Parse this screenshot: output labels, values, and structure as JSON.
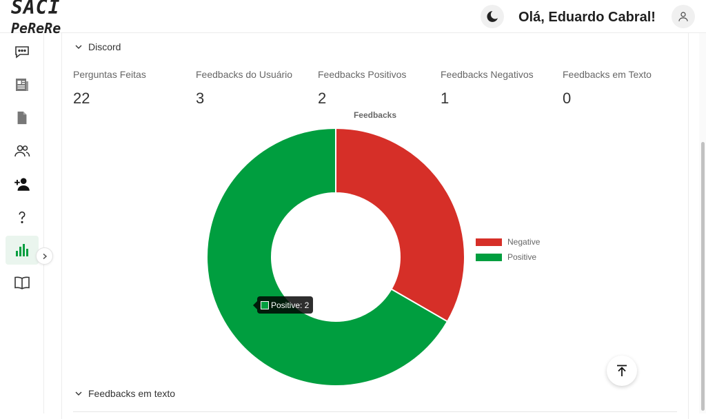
{
  "header": {
    "logo_line1": "SACI",
    "logo_line2": "PeReRe",
    "greeting": "Olá, Eduardo Cabral!"
  },
  "sidebar": {
    "items": [
      {
        "icon": "chat-icon"
      },
      {
        "icon": "newspaper-icon"
      },
      {
        "icon": "document-icon"
      },
      {
        "icon": "users-icon"
      },
      {
        "icon": "add-user-icon"
      },
      {
        "icon": "help-icon"
      },
      {
        "icon": "bar-chart-icon",
        "active": true
      },
      {
        "icon": "book-icon"
      }
    ]
  },
  "discord": {
    "section_label": "Discord",
    "stats": [
      {
        "label": "Perguntas Feitas",
        "value": "22"
      },
      {
        "label": "Feedbacks do Usuário",
        "value": "3"
      },
      {
        "label": "Feedbacks Positivos",
        "value": "2"
      },
      {
        "label": "Feedbacks Negativos",
        "value": "1"
      },
      {
        "label": "Feedbacks em Texto",
        "value": "0"
      }
    ]
  },
  "chart_data": {
    "type": "pie",
    "title": "Feedbacks",
    "categories": [
      "Negative",
      "Positive"
    ],
    "values": [
      1,
      2
    ],
    "colors": [
      "#d62f28",
      "#009e3f"
    ],
    "legend_position": "right",
    "tooltip": "Positive: 2"
  },
  "text_feedback": {
    "section_label": "Feedbacks em texto"
  },
  "colors": {
    "accent": "#009e3f",
    "negative": "#d62f28",
    "active_bg": "#eaf5ee"
  }
}
